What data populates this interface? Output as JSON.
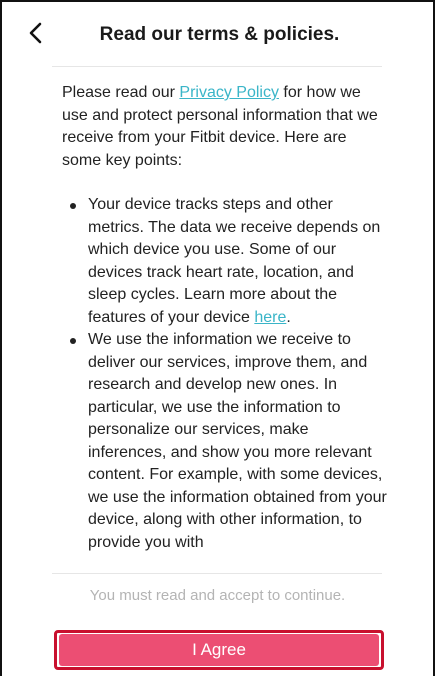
{
  "header": {
    "title": "Read our terms & policies."
  },
  "content": {
    "intro_before": "Please read our ",
    "privacy_link": "Privacy Policy",
    "intro_after": " for how we use and protect personal information that we receive from your Fitbit device. Here are some key points:",
    "points": [
      {
        "text_before": "Your device tracks steps and other metrics. The data we receive depends on which device you use. Some of our devices track heart rate, location, and sleep cycles. Learn more about the features of your device ",
        "link": "here",
        "text_after": "."
      },
      {
        "text": "We use the information we receive to deliver our services, improve them, and research and develop new ones. In particular, we use the information to personalize our services, make inferences, and show you more relevant content. For example, with some devices, we use the information obtained from your device, along with other information, to provide you with"
      }
    ]
  },
  "footer": {
    "notice": "You must read and accept to continue.",
    "agree_label": "I Agree"
  },
  "colors": {
    "link": "#3ab5c8",
    "agree_button": "#ec4e73",
    "agree_outline": "#c8102e",
    "notice_text": "#b4b4b4"
  }
}
